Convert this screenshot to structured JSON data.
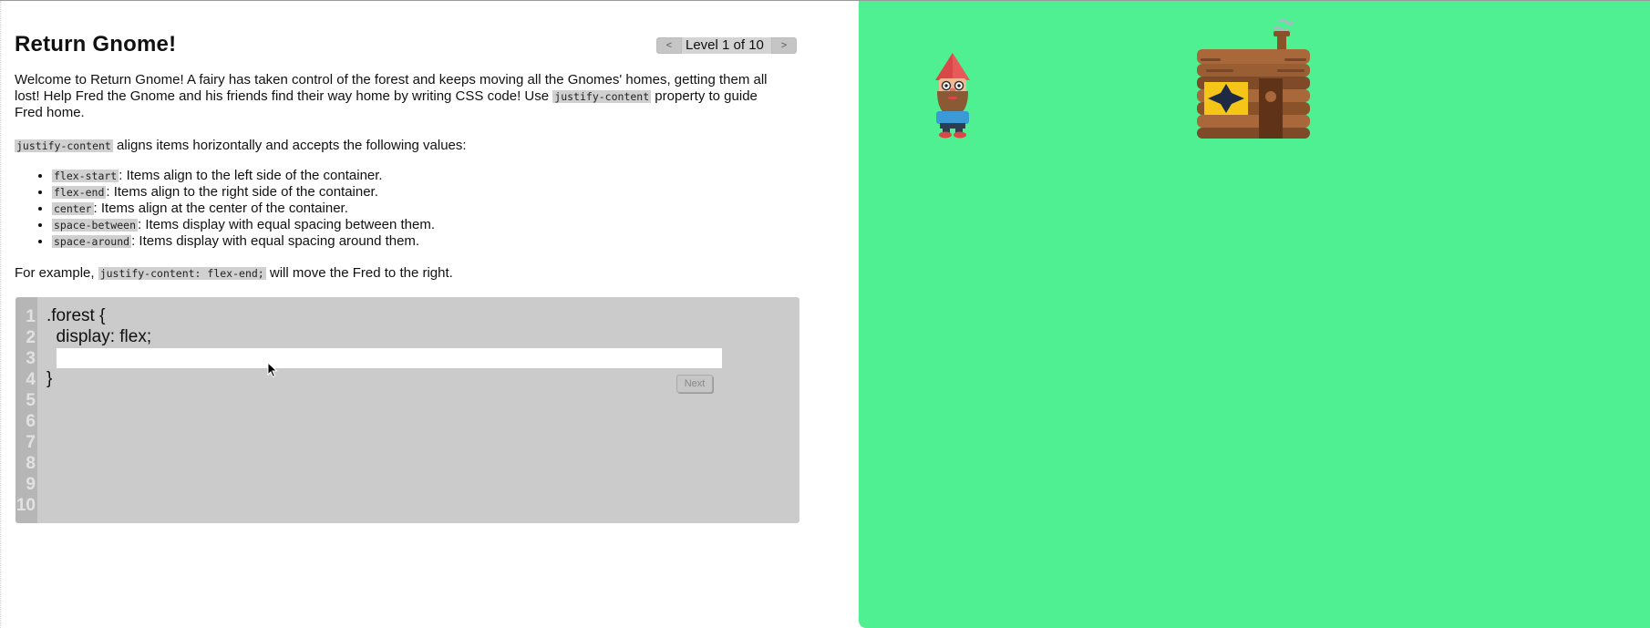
{
  "title": "Return Gnome!",
  "level_nav": {
    "prev_label": "<",
    "level_text": "Level 1 of 10",
    "next_label": ">"
  },
  "intro": {
    "part1": "Welcome to Return Gnome! A fairy has taken control of the forest and keeps moving all the Gnomes' homes, getting them all lost! Help Fred the Gnome and his friends find their way home by writing CSS code! Use ",
    "code": "justify-content",
    "part2": " property to guide Fred home."
  },
  "description": {
    "code": "justify-content",
    "text": " aligns items horizontally and accepts the following values:"
  },
  "values": [
    {
      "code": "flex-start",
      "text": ": Items align to the left side of the container."
    },
    {
      "code": "flex-end",
      "text": ": Items align to the right side of the container."
    },
    {
      "code": "center",
      "text": ": Items align at the center of the container."
    },
    {
      "code": "space-between",
      "text": ": Items display with equal spacing between them."
    },
    {
      "code": "space-around",
      "text": ": Items display with equal spacing around them."
    }
  ],
  "example": {
    "prefix": "For example, ",
    "code": "justify-content: flex-end;",
    "suffix": " will move the Fred to the right."
  },
  "editor": {
    "line_numbers": [
      "1",
      "2",
      "3",
      "4",
      "5",
      "6",
      "7",
      "8",
      "9",
      "10"
    ],
    "line1": ".forest {",
    "line2": "  display: flex;",
    "line4": "}",
    "input_value": "",
    "input_placeholder": "",
    "next_label": "Next"
  },
  "board": {
    "background": "#4ef092",
    "gnome_icon": "gnome-icon",
    "house_icon": "house-icon"
  }
}
